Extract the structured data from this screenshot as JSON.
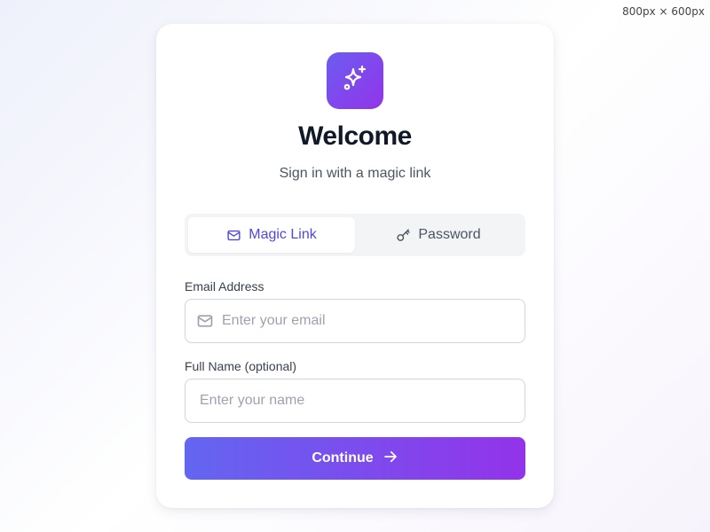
{
  "viewport_label": "800px × 600px",
  "brand": {
    "icon": "sparkles-icon"
  },
  "header": {
    "title": "Welcome",
    "subtitle": "Sign in with a magic link"
  },
  "tabs": [
    {
      "label": "Magic Link",
      "icon": "mail-icon",
      "active": true
    },
    {
      "label": "Password",
      "icon": "key-icon",
      "active": false
    }
  ],
  "form": {
    "email": {
      "label": "Email Address",
      "placeholder": "Enter your email",
      "value": "",
      "icon": "mail-icon"
    },
    "name": {
      "label": "Full Name (optional)",
      "placeholder": "Enter your name",
      "value": ""
    }
  },
  "submit": {
    "label": "Continue",
    "icon": "arrow-right-icon"
  },
  "colors": {
    "accent": "#4f46e5",
    "gradient_start": "#6366f1",
    "gradient_end": "#9333ea"
  }
}
